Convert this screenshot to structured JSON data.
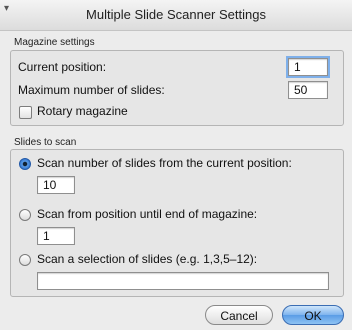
{
  "window": {
    "title": "Multiple Slide Scanner Settings"
  },
  "magazine_settings": {
    "group_label": "Magazine settings",
    "current_position_label": "Current position:",
    "current_position_value": "1",
    "max_slides_label": "Maximum number of slides:",
    "max_slides_value": "50",
    "rotary_label": "Rotary magazine",
    "rotary_checked": false
  },
  "slides_to_scan": {
    "group_label": "Slides to scan",
    "options": [
      {
        "label": "Scan number of slides from the current position:",
        "value": "10",
        "selected": true
      },
      {
        "label": "Scan from position until end of magazine:",
        "value": "1",
        "selected": false
      },
      {
        "label": "Scan a selection of slides (e.g. 1,3,5–12):",
        "value": "",
        "selected": false
      }
    ]
  },
  "buttons": {
    "cancel": "Cancel",
    "ok": "OK"
  },
  "colors": {
    "accent": "#2a6fc9",
    "window_bg": "#ececec"
  }
}
